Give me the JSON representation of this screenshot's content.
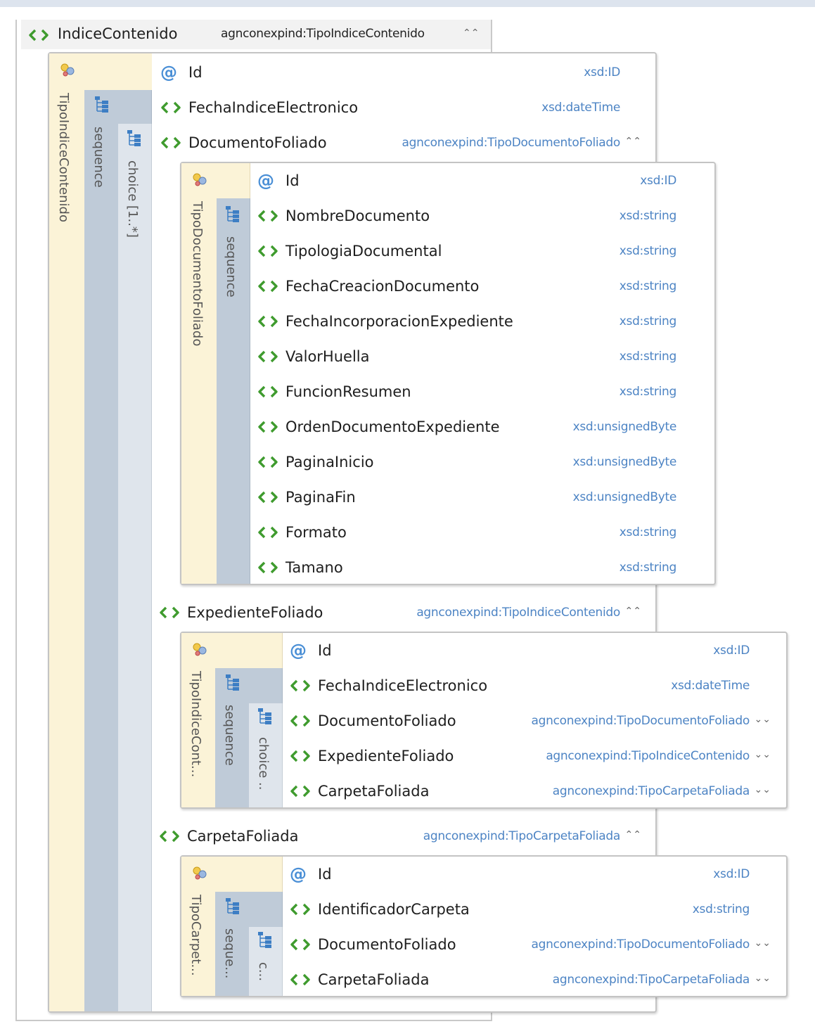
{
  "root": {
    "name": "IndiceContenido",
    "type": "agnconexpind:TipoIndiceContenido",
    "complex_type_label": "TipoIndiceContenido",
    "sequence_label": "sequence",
    "choice_label": "choice [1..*]",
    "rows": [
      {
        "kind": "attribute",
        "name": "Id",
        "type": "xsd:ID"
      },
      {
        "kind": "element",
        "name": "FechaIndiceElectronico",
        "type": "xsd:dateTime"
      },
      {
        "kind": "element",
        "name": "DocumentoFoliado",
        "type": "agnconexpind:TipoDocumentoFoliado",
        "expanded": true
      },
      {
        "kind": "element",
        "name": "ExpedienteFoliado",
        "type": "agnconexpind:TipoIndiceContenido",
        "expanded": true
      },
      {
        "kind": "element",
        "name": "CarpetaFoliada",
        "type": "agnconexpind:TipoCarpetaFoliada",
        "expanded": true
      }
    ]
  },
  "documento_box": {
    "complex_type_label": "TipoDocumentoFoliado",
    "sequence_label": "sequence",
    "rows": [
      {
        "kind": "attribute",
        "name": "Id",
        "type": "xsd:ID"
      },
      {
        "kind": "element",
        "name": "NombreDocumento",
        "type": "xsd:string"
      },
      {
        "kind": "element",
        "name": "TipologiaDocumental",
        "type": "xsd:string"
      },
      {
        "kind": "element",
        "name": "FechaCreacionDocumento",
        "type": "xsd:string"
      },
      {
        "kind": "element",
        "name": "FechaIncorporacionExpediente",
        "type": "xsd:string"
      },
      {
        "kind": "element",
        "name": "ValorHuella",
        "type": "xsd:string"
      },
      {
        "kind": "element",
        "name": "FuncionResumen",
        "type": "xsd:string"
      },
      {
        "kind": "element",
        "name": "OrdenDocumentoExpediente",
        "type": "xsd:unsignedByte"
      },
      {
        "kind": "element",
        "name": "PaginaInicio",
        "type": "xsd:unsignedByte"
      },
      {
        "kind": "element",
        "name": "PaginaFin",
        "type": "xsd:unsignedByte"
      },
      {
        "kind": "element",
        "name": "Formato",
        "type": "xsd:string"
      },
      {
        "kind": "element",
        "name": "Tamano",
        "type": "xsd:string"
      }
    ]
  },
  "expediente_box": {
    "complex_type_label": "TipoIndiceCont...",
    "sequence_label": "sequence",
    "choice_label": "choice ..",
    "rows": [
      {
        "kind": "attribute",
        "name": "Id",
        "type": "xsd:ID"
      },
      {
        "kind": "element",
        "name": "FechaIndiceElectronico",
        "type": "xsd:dateTime"
      },
      {
        "kind": "element",
        "name": "DocumentoFoliado",
        "type": "agnconexpind:TipoDocumentoFoliado",
        "expanded": false
      },
      {
        "kind": "element",
        "name": "ExpedienteFoliado",
        "type": "agnconexpind:TipoIndiceContenido",
        "expanded": false
      },
      {
        "kind": "element",
        "name": "CarpetaFoliada",
        "type": "agnconexpind:TipoCarpetaFoliada",
        "expanded": false
      }
    ]
  },
  "carpeta_box": {
    "complex_type_label": "TipoCarpet...",
    "sequence_label": "seque...",
    "choice_label": "c...",
    "rows": [
      {
        "kind": "attribute",
        "name": "Id",
        "type": "xsd:ID"
      },
      {
        "kind": "element",
        "name": "IdentificadorCarpeta",
        "type": "xsd:string"
      },
      {
        "kind": "element",
        "name": "DocumentoFoliado",
        "type": "agnconexpind:TipoDocumentoFoliado",
        "expanded": false
      },
      {
        "kind": "element",
        "name": "CarpetaFoliada",
        "type": "agnconexpind:TipoCarpetaFoliada",
        "expanded": false
      }
    ]
  },
  "icons": {
    "element": "element-icon",
    "attribute": "attribute-icon",
    "complex_type": "complex-type-icon",
    "sequence": "sequence-icon",
    "collapse": "chevron-up-icon",
    "expand": "chevron-down-icon"
  },
  "colors": {
    "type_text": "#4d84c4",
    "element_icon": "#3f9b2e",
    "attribute_icon": "#4a8fd6",
    "complex_type_column": "#fbf3d7",
    "sequence_column": "#bfcbd8"
  }
}
